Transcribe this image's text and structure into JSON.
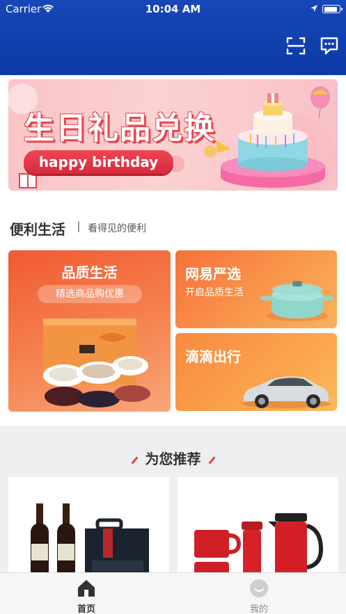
{
  "status_bar": {
    "carrier": "Carrier",
    "time": "10:04 AM"
  },
  "header": {
    "scan_icon": "scan-icon",
    "message_icon": "message-icon"
  },
  "banner": {
    "title": "生日礼品兑换",
    "pill": "happy birthday"
  },
  "convenience": {
    "title": "便利生活",
    "subtitle": "看得见的便利",
    "cards": [
      {
        "title": "品质生活",
        "subtitle": "精选商品购优惠"
      },
      {
        "title": "网易严选",
        "subtitle": "开启品质生活"
      },
      {
        "title": "滴滴出行",
        "subtitle": ""
      }
    ]
  },
  "recommend": {
    "title": "为您推荐"
  },
  "tabbar": {
    "items": [
      {
        "label": "首页",
        "icon": "home-icon",
        "active": true
      },
      {
        "label": "我的",
        "icon": "profile-icon",
        "active": false
      }
    ]
  },
  "colors": {
    "header": "#0c3aa6",
    "accent": "#e84040",
    "card_orange": "#f6713a"
  }
}
